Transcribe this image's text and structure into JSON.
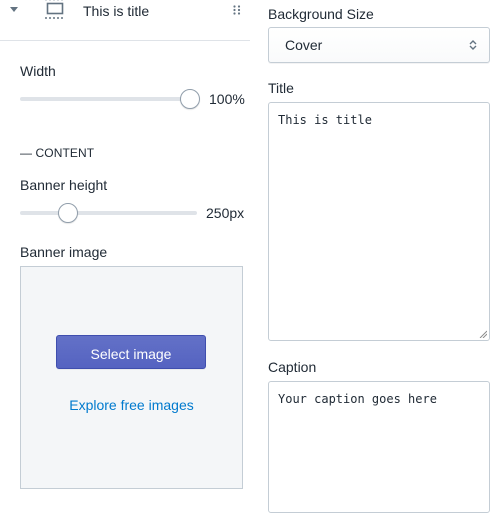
{
  "left_panel": {
    "section": {
      "title": "This is title"
    },
    "width": {
      "label": "Width",
      "value_text": "100%",
      "fraction": 1.0
    },
    "content_heading": "— CONTENT",
    "banner_height": {
      "label": "Banner height",
      "value_text": "250px",
      "fraction": 0.27
    },
    "banner_image": {
      "label": "Banner image",
      "select_button": "Select image",
      "explore_link": "Explore free images"
    }
  },
  "right_panel": {
    "background_size": {
      "label": "Background Size",
      "value": "Cover"
    },
    "title_field": {
      "label": "Title",
      "value": "This is title"
    },
    "caption_field": {
      "label": "Caption",
      "value": "Your caption goes here"
    }
  },
  "colors": {
    "primary_button": "#5c6ac4",
    "link": "#007ace",
    "border": "#c4cdd5",
    "image_placeholder_bg": "#f4f6f8"
  }
}
